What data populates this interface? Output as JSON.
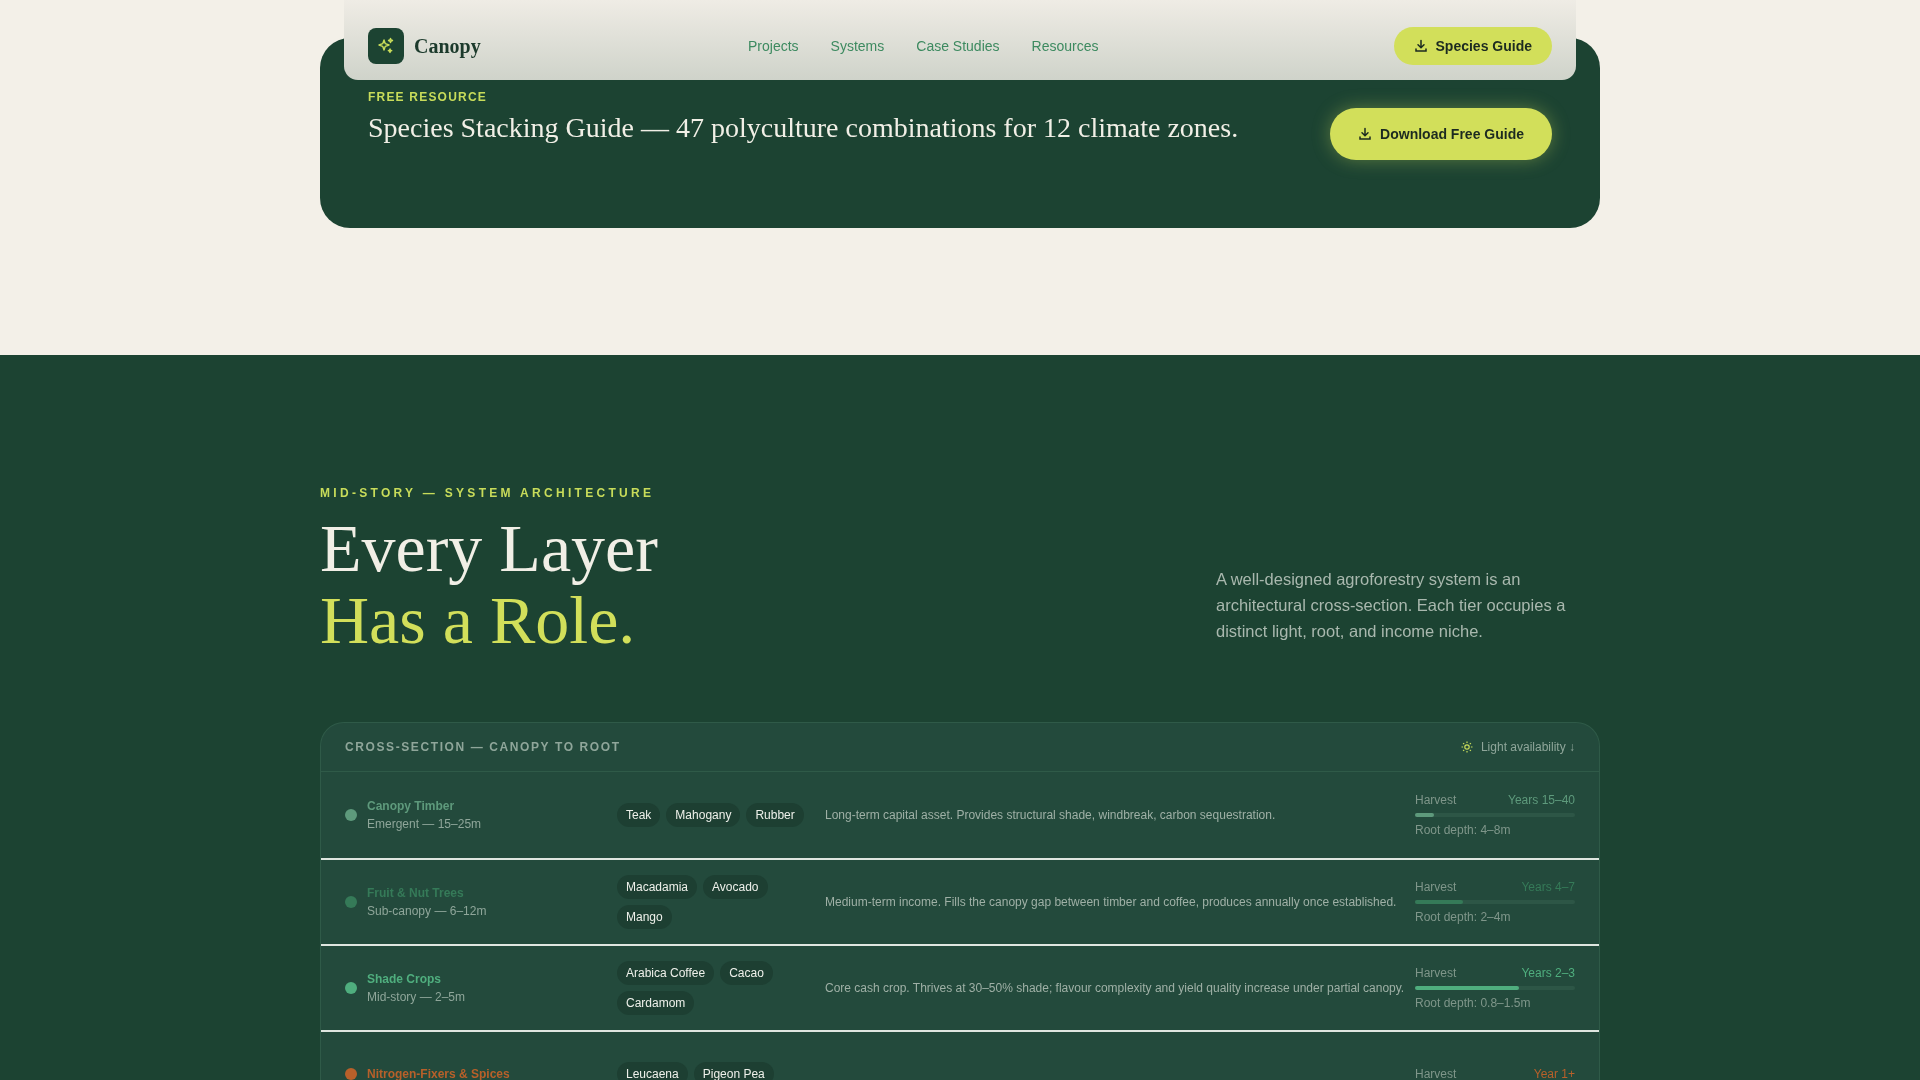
{
  "nav": {
    "brand": "Canopy",
    "links": [
      "Projects",
      "Systems",
      "Case Studies",
      "Resources"
    ],
    "cta": "Species Guide"
  },
  "banner": {
    "eyebrow": "FREE RESOURCE",
    "title": "Species Stacking Guide — 47 polyculture combinations for 12 climate zones.",
    "button": "Download Free Guide"
  },
  "section": {
    "eyebrow": "MID-STORY — SYSTEM ARCHITECTURE",
    "title_line1": "Every Layer",
    "title_line2": "Has a Role.",
    "description": "A well-designed agroforestry system is an architectural cross-section. Each tier occupies a distinct light, root, and income niche."
  },
  "table": {
    "title": "CROSS-SECTION — CANOPY TO ROOT",
    "legend": "Light availability ↓",
    "rows": [
      {
        "name": "Canopy Timber",
        "color": "#5e9a7c",
        "range": "Emergent — 15–25m",
        "tags": [
          "Teak",
          "Mahogany",
          "Rubber"
        ],
        "description": "Long-term capital asset. Provides structural shade, windbreak, carbon sequestration.",
        "harvest_label": "Harvest",
        "harvest": "Years 15–40",
        "level": 0.12,
        "root_depth": "Root depth: 4–8m"
      },
      {
        "name": "Fruit & Nut Trees",
        "color": "#357a58",
        "range": "Sub-canopy — 6–12m",
        "tags": [
          "Macadamia",
          "Avocado",
          "Mango"
        ],
        "description": "Medium-term income. Fills the canopy gap between timber and coffee, produces annually once established.",
        "harvest_label": "Harvest",
        "harvest": "Years 4–7",
        "level": 0.3,
        "root_depth": "Root depth: 2–4m"
      },
      {
        "name": "Shade Crops",
        "color": "#4fae7e",
        "range": "Mid-story — 2–5m",
        "tags": [
          "Arabica Coffee",
          "Cacao",
          "Cardamom"
        ],
        "description": "Core cash crop. Thrives at 30–50% shade; flavour complexity and yield quality increase under partial canopy.",
        "harvest_label": "Harvest",
        "harvest": "Years 2–3",
        "level": 0.65,
        "root_depth": "Root depth: 0.8–1.5m"
      },
      {
        "name": "Nitrogen-Fixers & Spices",
        "color": "#b8602a",
        "tags": [
          "Leucaena",
          "Pigeon Pea"
        ],
        "harvest_label": "Harvest",
        "harvest": "Year 1+"
      }
    ]
  }
}
